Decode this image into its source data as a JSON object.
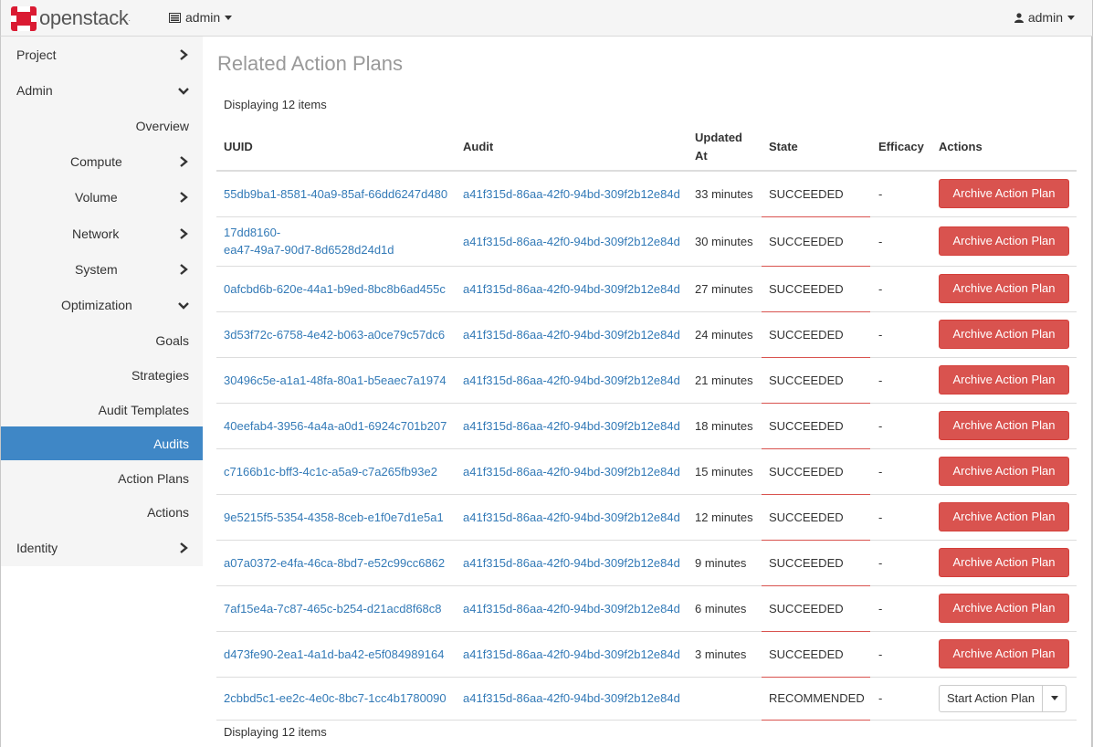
{
  "navbar": {
    "brand": "openstack",
    "project": "admin",
    "user": "admin",
    "icons": {
      "logo": "openstack-logo",
      "project": "server-list-icon",
      "user": "user-icon"
    }
  },
  "sidebar": {
    "active_color": "#3f87c6",
    "items": [
      {
        "label": "Project",
        "indicator": "chevron-right"
      },
      {
        "label": "Admin",
        "indicator": "chevron-down"
      },
      {
        "label": "Overview",
        "indicator": ""
      },
      {
        "label": "Compute",
        "indicator": "chevron-right"
      },
      {
        "label": "Volume",
        "indicator": "chevron-right"
      },
      {
        "label": "Network",
        "indicator": "chevron-right"
      },
      {
        "label": "System",
        "indicator": "chevron-right"
      },
      {
        "label": "Optimization",
        "indicator": "chevron-down"
      },
      {
        "label": "Goals",
        "indicator": ""
      },
      {
        "label": "Strategies",
        "indicator": ""
      },
      {
        "label": "Audit Templates",
        "indicator": ""
      },
      {
        "label": "Audits",
        "indicator": "",
        "active": true
      },
      {
        "label": "Action Plans",
        "indicator": ""
      },
      {
        "label": "Actions",
        "indicator": ""
      },
      {
        "label": "Identity",
        "indicator": "chevron-right"
      }
    ]
  },
  "main": {
    "title": "Related Action Plans",
    "count_text": "Displaying 12 items",
    "columns": {
      "uuid": "UUID",
      "audit": "Audit",
      "updated_line1": "Updated",
      "updated_line2": "At",
      "state": "State",
      "efficacy": "Efficacy",
      "actions": "Actions"
    },
    "archive_label": "Archive Action Plan",
    "start_label": "Start Action Plan",
    "rows": [
      {
        "uuid": "55db9ba1-8581-40a9-85af-66dd6247d480",
        "audit": "a41f315d-86aa-42f0-94bd-309f2b12e84d",
        "updated": "33 minutes",
        "state": "SUCCEEDED",
        "efficacy": "-"
      },
      {
        "uuid_line1": "17dd8160-",
        "uuid_line2": "ea47-49a7-90d7-8d6528d24d1d",
        "audit": "a41f315d-86aa-42f0-94bd-309f2b12e84d",
        "updated": "30 minutes",
        "state": "SUCCEEDED",
        "efficacy": "-"
      },
      {
        "uuid": "0afcbd6b-620e-44a1-b9ed-8bc8b6ad455c",
        "audit": "a41f315d-86aa-42f0-94bd-309f2b12e84d",
        "updated": "27 minutes",
        "state": "SUCCEEDED",
        "efficacy": "-"
      },
      {
        "uuid": "3d53f72c-6758-4e42-b063-a0ce79c57dc6",
        "audit": "a41f315d-86aa-42f0-94bd-309f2b12e84d",
        "updated": "24 minutes",
        "state": "SUCCEEDED",
        "efficacy": "-"
      },
      {
        "uuid": "30496c5e-a1a1-48fa-80a1-b5eaec7a1974",
        "audit": "a41f315d-86aa-42f0-94bd-309f2b12e84d",
        "updated": "21 minutes",
        "state": "SUCCEEDED",
        "efficacy": "-"
      },
      {
        "uuid": "40eefab4-3956-4a4a-a0d1-6924c701b207",
        "audit": "a41f315d-86aa-42f0-94bd-309f2b12e84d",
        "updated": "18 minutes",
        "state": "SUCCEEDED",
        "efficacy": "-"
      },
      {
        "uuid": "c7166b1c-bff3-4c1c-a5a9-c7a265fb93e2",
        "audit": "a41f315d-86aa-42f0-94bd-309f2b12e84d",
        "updated": "15 minutes",
        "state": "SUCCEEDED",
        "efficacy": "-"
      },
      {
        "uuid": "9e5215f5-5354-4358-8ceb-e1f0e7d1e5a1",
        "audit": "a41f315d-86aa-42f0-94bd-309f2b12e84d",
        "updated": "12 minutes",
        "state": "SUCCEEDED",
        "efficacy": "-"
      },
      {
        "uuid": "a07a0372-e4fa-46ca-8bd7-e52c99cc6862",
        "audit": "a41f315d-86aa-42f0-94bd-309f2b12e84d",
        "updated": "9 minutes",
        "state": "SUCCEEDED",
        "efficacy": "-"
      },
      {
        "uuid": "7af15e4a-7c87-465c-b254-d21acd8f68c8",
        "audit": "a41f315d-86aa-42f0-94bd-309f2b12e84d",
        "updated": "6 minutes",
        "state": "SUCCEEDED",
        "efficacy": "-"
      },
      {
        "uuid": "d473fe90-2ea1-4a1d-ba42-e5f084989164",
        "audit": "a41f315d-86aa-42f0-94bd-309f2b12e84d",
        "updated": "3 minutes",
        "state": "SUCCEEDED",
        "efficacy": "-"
      },
      {
        "uuid": "2cbbd5c1-ee2c-4e0c-8bc7-1cc4b1780090",
        "audit": "a41f315d-86aa-42f0-94bd-309f2b12e84d",
        "updated": "",
        "state": "RECOMMENDED",
        "efficacy": "-"
      }
    ],
    "colors": {
      "link": "#337ab7",
      "danger": "#d9534f"
    }
  }
}
